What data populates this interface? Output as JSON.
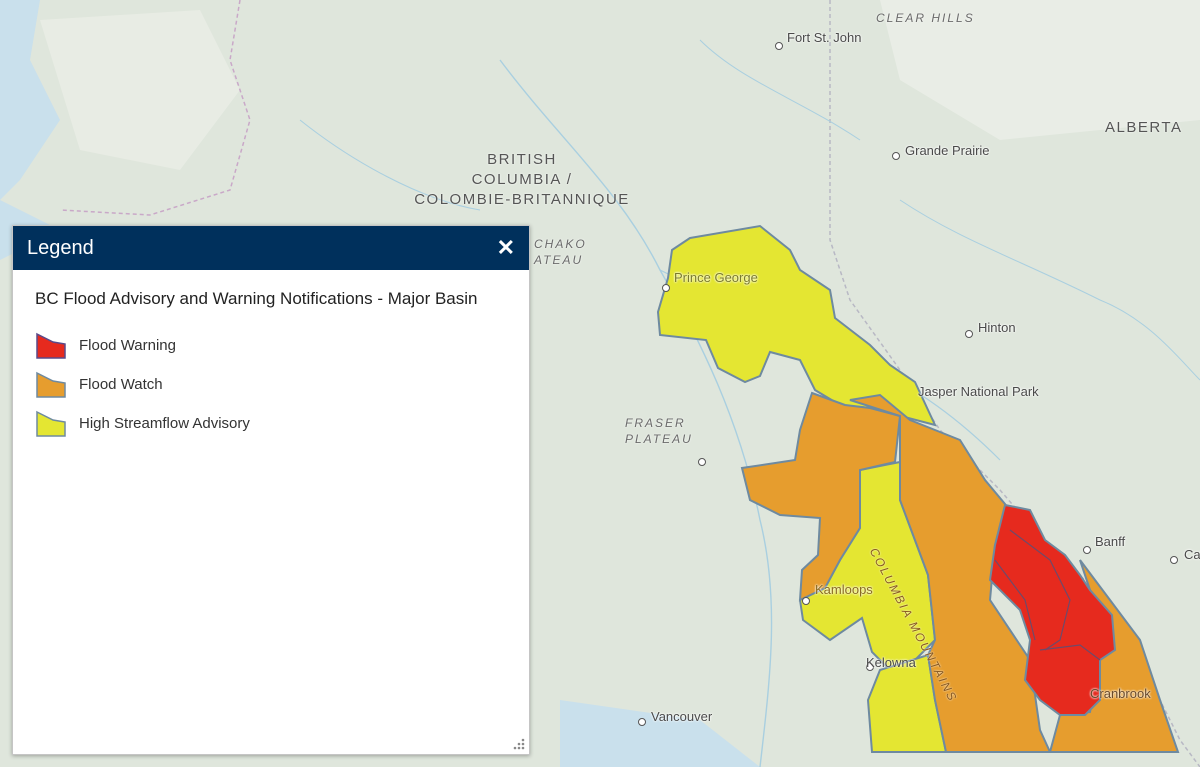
{
  "map": {
    "colors": {
      "flood_warning": "#e62a1e",
      "flood_watch": "#e69d2e",
      "high_streamflow": "#e4e632",
      "basin_outline": "#6e8aa0",
      "land": "#dfe6dc",
      "water": "#c9e0ec"
    },
    "region_labels": {
      "bc": "BRITISH\nCOLUMBIA /\nCOLOMBIE-BRITANNIQUE",
      "alberta": "ALBERTA"
    },
    "feature_labels": {
      "clear_hills": "CLEAR HILLS",
      "nechako": "CHAKO\nATEAU",
      "fraser_plateau": "FRASER\nPLATEAU",
      "columbia_mountains": "COLUMBIA MOUNTAINS"
    },
    "places": [
      {
        "id": "fort-st-john",
        "name": "Fort St. John"
      },
      {
        "id": "grande-prairie",
        "name": "Grande Prairie"
      },
      {
        "id": "prince-george",
        "name": "Prince George"
      },
      {
        "id": "hinton",
        "name": "Hinton"
      },
      {
        "id": "jasper",
        "name": "Jasper National Park"
      },
      {
        "id": "banff",
        "name": "Banff"
      },
      {
        "id": "calgary",
        "name": "Ca"
      },
      {
        "id": "kamloops",
        "name": "Kamloops"
      },
      {
        "id": "kelowna",
        "name": "Kelowna"
      },
      {
        "id": "vancouver",
        "name": "Vancouver"
      },
      {
        "id": "cranbrook",
        "name": "Cranbrook"
      }
    ]
  },
  "legend": {
    "title": "Legend",
    "close_icon": "close-icon",
    "layer_title": "BC Flood Advisory and Warning Notifications - Major Basin",
    "items": [
      {
        "label": "Flood Warning",
        "color": "#e62a1e"
      },
      {
        "label": "Flood Watch",
        "color": "#e69d2e"
      },
      {
        "label": "High Streamflow Advisory",
        "color": "#e4e632"
      }
    ]
  }
}
